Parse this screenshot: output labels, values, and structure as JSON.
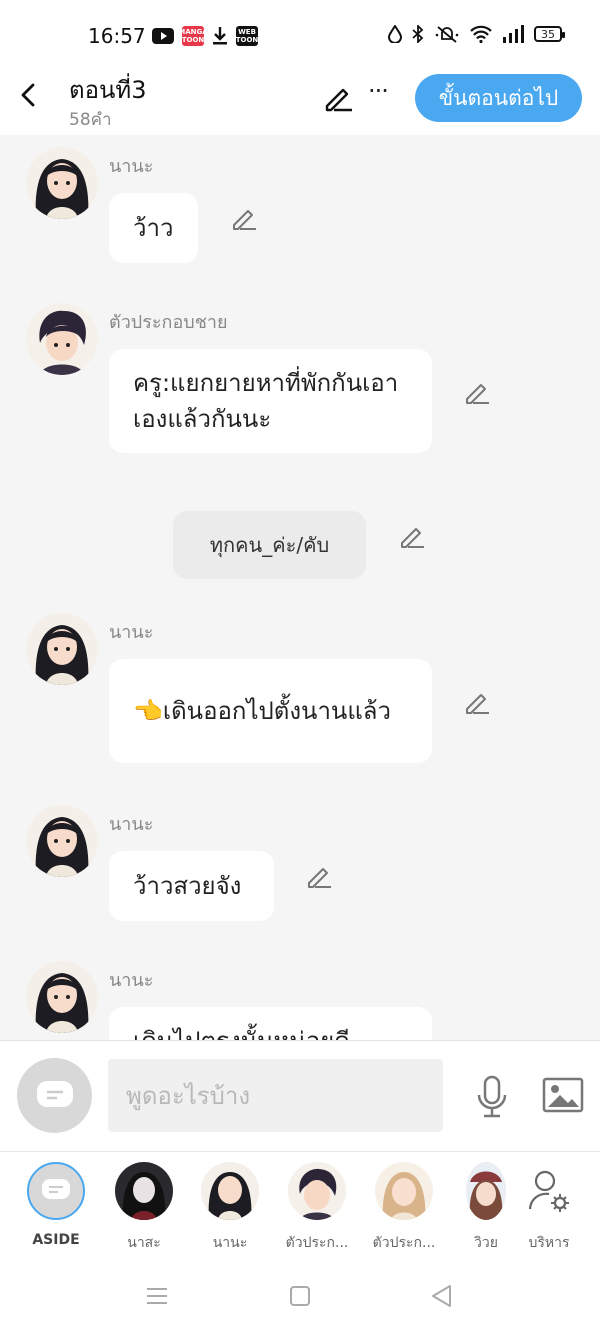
{
  "status_bar": {
    "time": "16:57",
    "battery": "35",
    "apps": [
      {
        "name": "youtube-icon"
      },
      {
        "name": "mangatoon-icon",
        "label": "MANGA TOON"
      },
      {
        "name": "download-icon"
      },
      {
        "name": "webtoon-icon",
        "label": "WEB TOON"
      }
    ]
  },
  "header": {
    "title": "ตอนที่3",
    "subtitle": "58คำ",
    "next_button": "ขั้นตอนต่อไป"
  },
  "messages": [
    {
      "sender": "นานะ",
      "text": "ว้าว"
    },
    {
      "sender": "ตัวประกอบชาย",
      "text": "ครู:แยกยายหาที่พักกันเอาเองแล้วกันนะ"
    },
    {
      "system": "ทุกคน_ค่ะ/คับ"
    },
    {
      "sender": "นานะ",
      "text": "👈เดินออกไปตั้งนานแล้ว"
    },
    {
      "sender": "นานะ",
      "text": "ว้าวสวยจัง"
    },
    {
      "sender": "นานะ",
      "text": "เดินไปตรงนั้นหน่อยดี"
    }
  ],
  "input": {
    "placeholder": "พูดอะไรบ้าง"
  },
  "characters": [
    {
      "name": "ASIDE"
    },
    {
      "name": "นาสะ"
    },
    {
      "name": "นานะ"
    },
    {
      "name": "ตัวประก..."
    },
    {
      "name": "ตัวประก..."
    },
    {
      "name": "วิวย"
    },
    {
      "name": "บริหาร"
    }
  ],
  "colors": {
    "accent": "#4aa8f0",
    "background": "#f5f5f5"
  }
}
